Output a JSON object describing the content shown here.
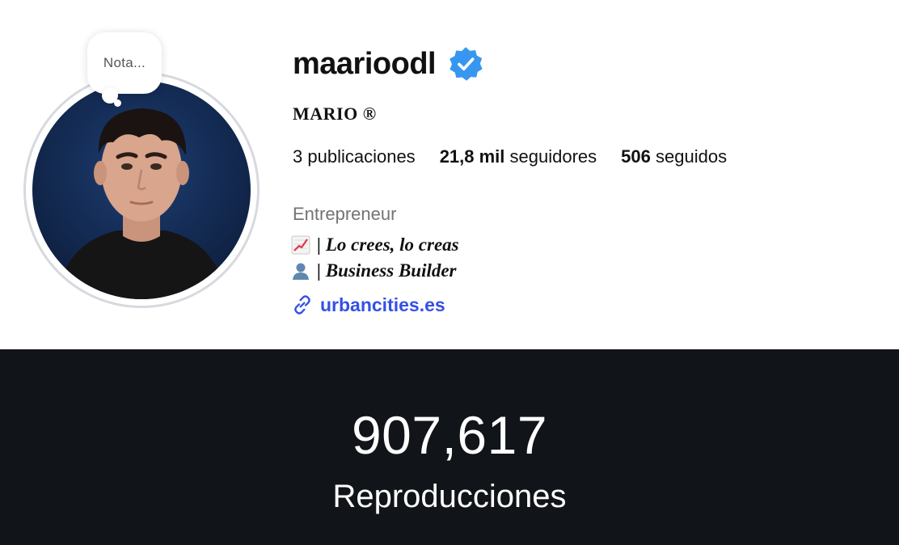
{
  "profile": {
    "note_text": "Nota...",
    "username": "maarioodl",
    "verified_icon": "verified-badge-icon",
    "full_name": "MARIO ®",
    "stats": {
      "posts_value": "3",
      "posts_label": "publicaciones",
      "followers_value": "21,8 mil",
      "followers_label": "seguidores",
      "following_value": "506",
      "following_label": "seguidos"
    },
    "category": "Entrepreneur",
    "bio": [
      {
        "icon": "chart-increasing-icon",
        "text": "| Lo crees, lo creas"
      },
      {
        "icon": "bust-silhouette-icon",
        "text": "| Business Builder"
      }
    ],
    "link": {
      "icon": "link-icon",
      "text": "urbancities.es"
    }
  },
  "views": {
    "count": "907,617",
    "label": "Reproducciones"
  },
  "colors": {
    "verified_blue": "#3797f0",
    "link_blue": "#3550e6",
    "panel_bg": "#111418",
    "muted_text": "#737373"
  }
}
